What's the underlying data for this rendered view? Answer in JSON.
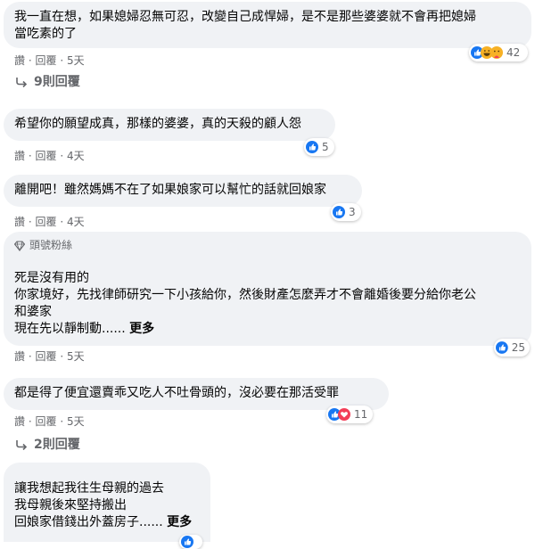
{
  "comments": [
    {
      "lines": [
        "我一直在想，如果媳婦忍無可忍，改變自己成悍婦，是不是那些婆婆就不會再把媳婦",
        "當吃素的了"
      ],
      "more": "",
      "likes": "42",
      "time": "5天"
    },
    {
      "lines": [
        "希望你的願望成真，那樣的婆婆，真的天殺的顧人怨"
      ],
      "more": "",
      "likes": "5",
      "time": "4天"
    },
    {
      "lines": [
        "離開吧！雖然媽媽不在了如果娘家可以幫忙的話就回娘家"
      ],
      "more": "",
      "likes": "3",
      "time": "4天"
    },
    {
      "badge": "頭號粉絲",
      "lines": [
        "死是沒有用的",
        "你家境好，先找律師研究一下小孩給你，然後財產怎麼弄才不會離婚後要分給你老公",
        "和婆家",
        "現在先以靜制動......"
      ],
      "more": "更多",
      "likes": "25",
      "time": "5天"
    },
    {
      "lines": [
        "都是得了便宜還賣乖又吃人不吐骨頭的，沒必要在那活受罪"
      ],
      "more": "",
      "likes": "11",
      "time": "5天"
    },
    {
      "lines": [
        "讓我想起我往生母親的過去",
        "我母親後來堅持搬出",
        "回娘家借錢出外蓋房子......"
      ],
      "more": "更多",
      "likes": "",
      "time": ""
    }
  ],
  "actions": {
    "like": "讚",
    "reply": "回覆",
    "sep": "·"
  },
  "replies": [
    "9則回覆",
    "2則回覆"
  ],
  "colors": {
    "bubble": "#f0f2f5",
    "meta": "#65676b",
    "like_blue": "#1877f2",
    "love_red": "#f33e58",
    "haha_yellow": "#f7b125"
  }
}
